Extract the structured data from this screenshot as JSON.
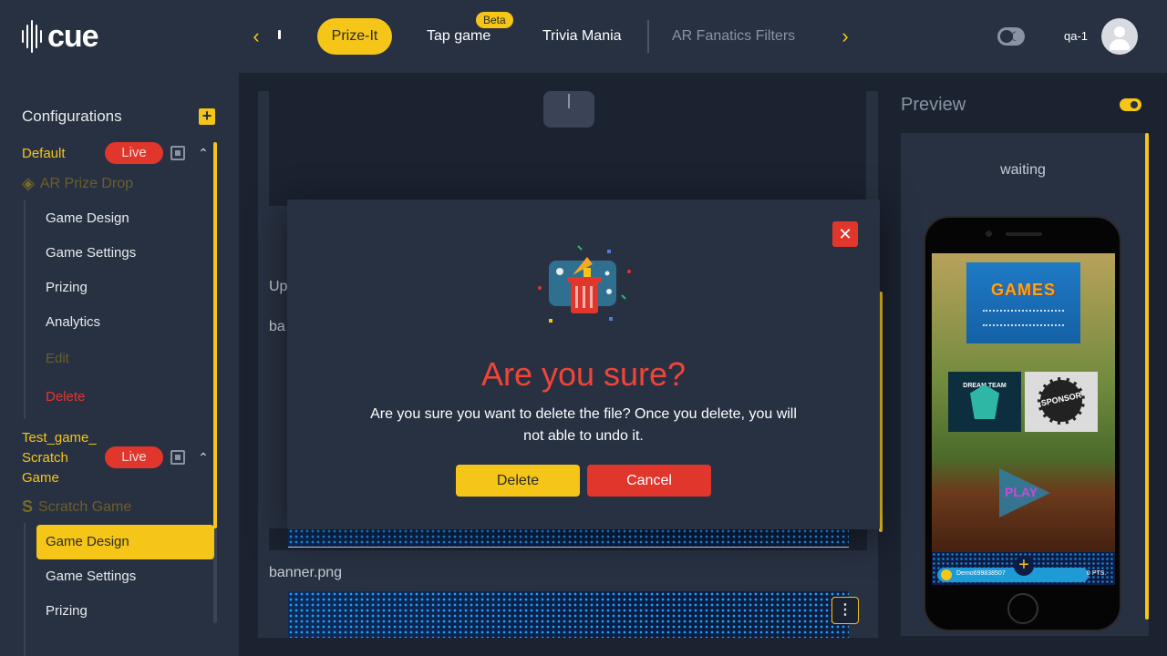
{
  "header": {
    "logo_text": "cue",
    "tabs": [
      {
        "label": "Prize-It",
        "active": true
      },
      {
        "label": "Tap game",
        "badge": "Beta"
      },
      {
        "label": "Trivia Mania"
      },
      {
        "label": "AR Fanatics Filters",
        "disabled": true
      }
    ],
    "username": "qa-1",
    "icons": [
      "chevron-left-icon",
      "chevron-right-icon",
      "theme-toggle-icon",
      "user-avatar-icon"
    ]
  },
  "sidebar": {
    "title": "Configurations",
    "groups": [
      {
        "name": "Default",
        "status": "Live",
        "game_type": "AR Prize Drop",
        "items": [
          "Game Design",
          "Game Settings",
          "Prizing",
          "Analytics",
          "Edit",
          "Delete"
        ]
      },
      {
        "name": "Test_game_\nScratch\nGame",
        "status": "Live",
        "game_type": "Scratch Game",
        "items": [
          "Game Design",
          "Game Settings",
          "Prizing"
        ],
        "active_item": "Game Design"
      }
    ]
  },
  "main": {
    "upload_fragment": "Up",
    "background_fragment": "ba",
    "banner_filename": "banner.png"
  },
  "preview": {
    "title": "Preview",
    "status": "waiting",
    "phone": {
      "games_title": "GAMES",
      "team_name": "DREAM TEAM",
      "sponsor_text": "SPONSOR",
      "play_label": "PLAY",
      "player_id": "Demo699838507",
      "points": "0 PTS."
    }
  },
  "modal": {
    "title": "Are you sure?",
    "message": "Are you sure you want to delete the file? Once you delete, you will not able to undo it.",
    "delete_label": "Delete",
    "cancel_label": "Cancel"
  },
  "colors": {
    "accent": "#f5c518",
    "danger": "#e0362c",
    "panel": "#283142",
    "background": "#1b2230"
  }
}
